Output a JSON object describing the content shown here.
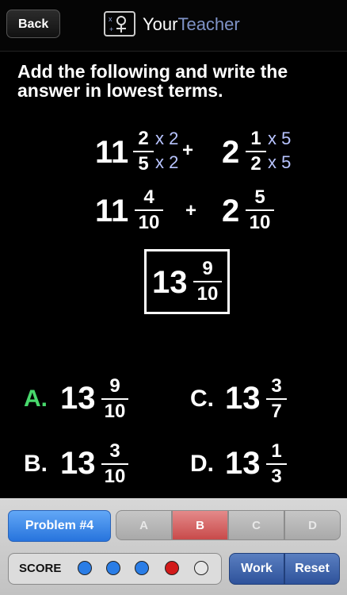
{
  "nav": {
    "back_label": "Back",
    "brand_your": "Your",
    "brand_teacher": "Teacher"
  },
  "question": "Add the following and write the answer in lowest terms.",
  "step1": {
    "whole1": "11",
    "num1": "2",
    "den1": "5",
    "mult_num1": "x 2",
    "mult_den1": "x 2",
    "plus": "+",
    "whole2": "2",
    "num2": "1",
    "den2": "2",
    "mult_num2": "x 5",
    "mult_den2": "x 5"
  },
  "step2": {
    "whole1": "11",
    "num1": "4",
    "den1": "10",
    "plus": "+",
    "whole2": "2",
    "num2": "5",
    "den2": "10"
  },
  "result": {
    "whole": "13",
    "num": "9",
    "den": "10"
  },
  "choices": [
    {
      "letter": "A.",
      "whole": "13",
      "num": "9",
      "den": "10"
    },
    {
      "letter": "C.",
      "whole": "13",
      "num": "3",
      "den": "7"
    },
    {
      "letter": "B.",
      "whole": "13",
      "num": "3",
      "den": "10"
    },
    {
      "letter": "D.",
      "whole": "13",
      "num": "1",
      "den": "3"
    }
  ],
  "toolbar": {
    "problem_label": "Problem #4",
    "segments": [
      "A",
      "B",
      "C",
      "D"
    ],
    "selected_segment": "B",
    "score_label": "SCORE",
    "score_dots": [
      "blue",
      "blue",
      "blue",
      "red",
      "empty"
    ],
    "work_label": "Work",
    "reset_label": "Reset"
  },
  "colors": {
    "correct": "#48d86c",
    "accent_blue": "#2774dd",
    "multiplier": "#b8c4ff",
    "dot_blue": "#2a7de6",
    "dot_red": "#d21a1a"
  }
}
